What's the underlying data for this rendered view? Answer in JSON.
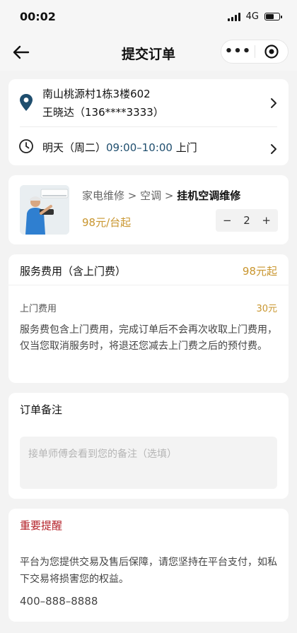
{
  "status_bar": {
    "time": "00:02",
    "network": "4G"
  },
  "nav": {
    "title": "提交订单",
    "back_icon": "arrow-left-icon",
    "more_label": "•••"
  },
  "address": {
    "line1": "南山桃源村1栋3楼602",
    "line2": "王晓达（136****3333）",
    "icon": "location-pin-icon"
  },
  "appointment": {
    "day": "明天（周二）",
    "slot": "09:00–10:00",
    "suffix": " 上门",
    "icon": "clock-icon"
  },
  "service": {
    "crumb_1": "家电维修",
    "crumb_2": "空调",
    "crumb_3": "挂机空调维修",
    "separator": " > ",
    "price": "98元/台起",
    "quantity": "2",
    "minus": "−",
    "plus": "+"
  },
  "fee": {
    "title": "服务费用（含上门费）",
    "from_price": "98元起",
    "visit_fee_label": "上门费用",
    "visit_fee_value": "30元",
    "description": "服务费包含上门费用，完成订单后不会再次收取上门费用，仅当您取消服务时，将退还您减去上门费之后的预付费。"
  },
  "remark": {
    "title": "订单备注",
    "placeholder": "接单师傅会看到您的备注（选填）"
  },
  "warning": {
    "title": "重要提醒",
    "text": "平台为您提供交易及售后保障，请您坚持在平台支付，如私下交易将损害您的权益。",
    "phone": "400–888–8888"
  },
  "colors": {
    "accent": "#c9962f",
    "time_highlight": "#1f4e6e",
    "warning": "#b4222a"
  }
}
